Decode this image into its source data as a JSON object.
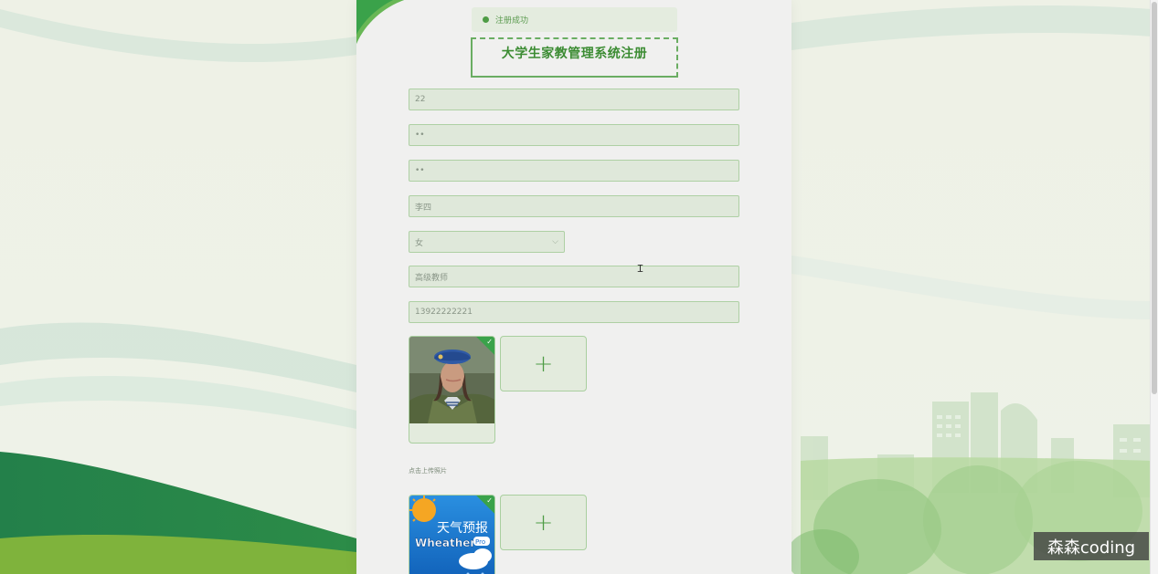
{
  "toast": {
    "message": "注册成功"
  },
  "form": {
    "title": "大学生家教管理系统注册",
    "fields": [
      {
        "name": "account",
        "value": "22"
      },
      {
        "name": "password",
        "value": "••"
      },
      {
        "name": "confirm_password",
        "value": "••"
      },
      {
        "name": "real_name",
        "value": "李四"
      },
      {
        "name": "gender",
        "value": "女"
      },
      {
        "name": "title",
        "value": "高级教师"
      },
      {
        "name": "phone",
        "value": "13922222221"
      }
    ],
    "upload_hint": "点击上传照片",
    "weather_text": "天气预报",
    "weather_brand": "Wheather",
    "weather_pro": "Pro"
  },
  "watermark": "森森coding",
  "colors": {
    "accent": "#4e9c45",
    "title": "#3c8c33",
    "field_bg": "#dfe8da",
    "field_border": "#aed0a4"
  }
}
